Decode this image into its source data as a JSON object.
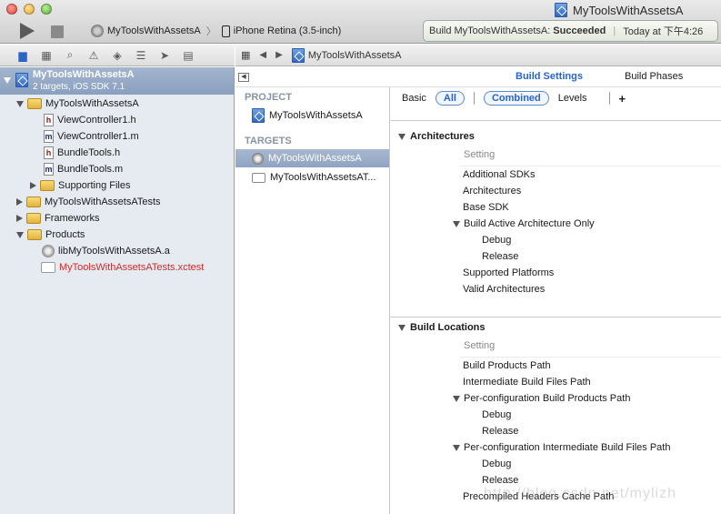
{
  "window": {
    "title": "MyToolsWithAssetsA"
  },
  "toolbar": {
    "scheme": "MyToolsWithAssetsA",
    "destination": "iPhone Retina (3.5-inch)",
    "status_prefix": "Build MyToolsWithAssetsA:",
    "status_result": "Succeeded",
    "status_time": "Today at 下午4:26"
  },
  "navigator": {
    "project": {
      "name": "MyToolsWithAssetsA",
      "subtitle": "2 targets, iOS SDK 7.1"
    },
    "items": [
      {
        "label": "MyToolsWithAssetsA",
        "kind": "folder",
        "expanded": true
      },
      {
        "label": "ViewController1.h",
        "kind": "h"
      },
      {
        "label": "ViewController1.m",
        "kind": "m"
      },
      {
        "label": "BundleTools.h",
        "kind": "h"
      },
      {
        "label": "BundleTools.m",
        "kind": "m"
      },
      {
        "label": "Supporting Files",
        "kind": "folder",
        "expanded": false
      },
      {
        "label": "MyToolsWithAssetsATests",
        "kind": "folder",
        "expanded": false
      },
      {
        "label": "Frameworks",
        "kind": "folder",
        "expanded": false
      },
      {
        "label": "Products",
        "kind": "folder",
        "expanded": true
      },
      {
        "label": "libMyToolsWithAssetsA.a",
        "kind": "lib"
      },
      {
        "label": "MyToolsWithAssetsATests.xctest",
        "kind": "xctest",
        "missing_color": "#d42a2a"
      }
    ]
  },
  "jumpbar": {
    "crumb": "MyToolsWithAssetsA"
  },
  "editor": {
    "tabs": {
      "build_settings": "Build Settings",
      "build_phases": "Build Phases"
    },
    "project_header": "PROJECT",
    "project_item": "MyToolsWithAssetsA",
    "targets_header": "TARGETS",
    "targets": [
      "MyToolsWithAssetsA",
      "MyToolsWithAssetsAT..."
    ],
    "filters": {
      "basic": "Basic",
      "all": "All",
      "combined": "Combined",
      "levels": "Levels",
      "add": "+"
    }
  },
  "settings": {
    "architectures": {
      "title": "Architectures",
      "column": "Setting",
      "rows": [
        "Additional SDKs",
        "Architectures",
        "Base SDK",
        "Build Active Architecture Only",
        "Debug",
        "Release",
        "Supported Platforms",
        "Valid Architectures"
      ]
    },
    "build_locations": {
      "title": "Build Locations",
      "column": "Setting",
      "rows": [
        "Build Products Path",
        "Intermediate Build Files Path",
        "Per-configuration Build Products Path",
        "Debug",
        "Release",
        "Per-configuration Intermediate Build Files Path",
        "Debug",
        "Release",
        "Precompiled Headers Cache Path"
      ]
    }
  },
  "watermark": "http://blog.csdn.net/mylizh"
}
